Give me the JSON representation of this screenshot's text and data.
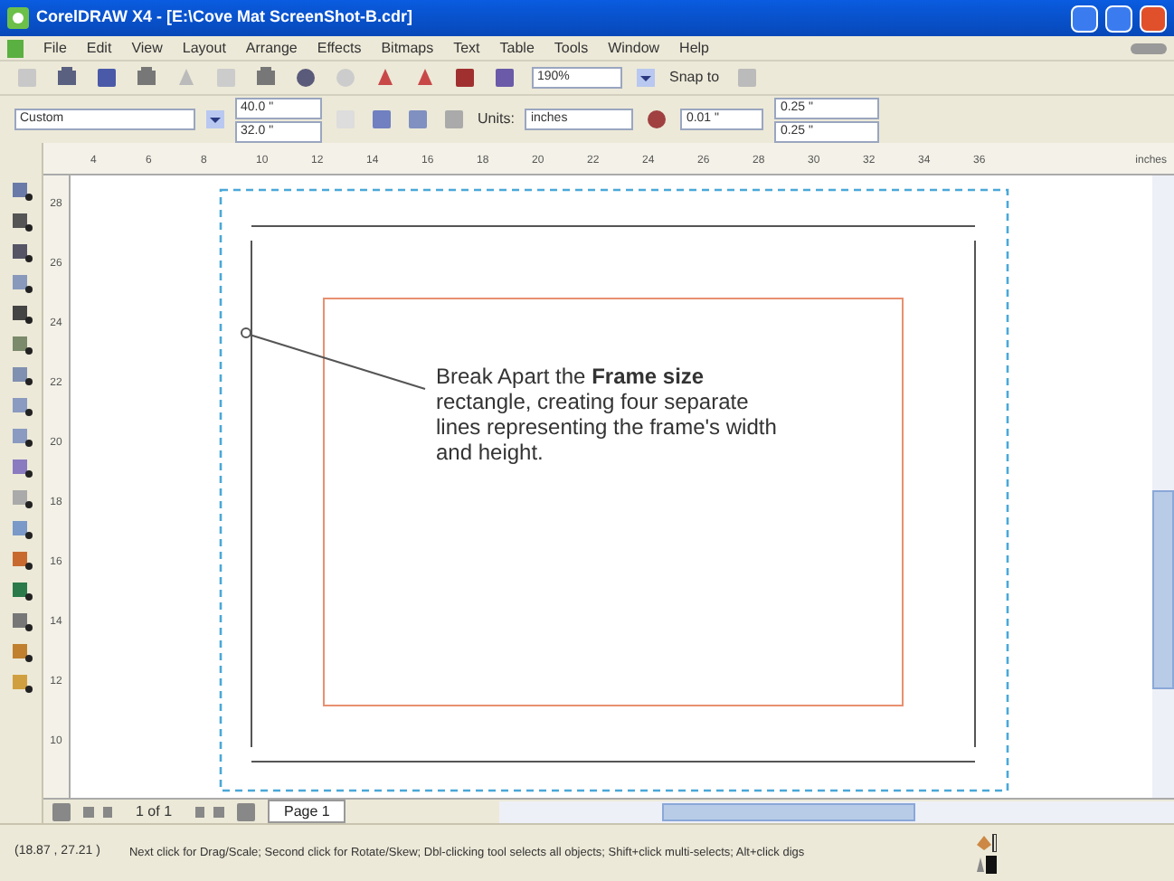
{
  "window": {
    "title": "CorelDRAW X4 - [E:\\Cove Mat ScreenShot-B.cdr]"
  },
  "menu": [
    "File",
    "Edit",
    "View",
    "Layout",
    "Arrange",
    "Effects",
    "Bitmaps",
    "Text",
    "Table",
    "Tools",
    "Window",
    "Help"
  ],
  "standard_toolbar": {
    "zoom": "190%",
    "snap_to": "Snap to"
  },
  "property_bar": {
    "paper_type": "Custom",
    "width": "40.0 \"",
    "height": "32.0 \"",
    "units_label": "Units:",
    "units": "inches",
    "nudge": "0.01 \"",
    "duplicate_x": "0.25 \"",
    "duplicate_y": "0.25 \""
  },
  "rulers": {
    "horizontal": [
      "4",
      "6",
      "8",
      "10",
      "12",
      "14",
      "16",
      "18",
      "20",
      "22",
      "24",
      "26",
      "28",
      "30",
      "32",
      "34",
      "36"
    ],
    "unit": "inches",
    "vertical": [
      "28",
      "26",
      "24",
      "22",
      "20",
      "18",
      "16",
      "14",
      "12",
      "10"
    ]
  },
  "callout": "Break Apart the **Frame size** rectangle, creating four separate lines representing the frame's width and height.",
  "page_nav": {
    "position": "1 of 1",
    "tabs": [
      {
        "label": "Page 1",
        "selected": true
      }
    ]
  },
  "status_bar": {
    "coordinates": "(18.87 , 27.21 )",
    "hint": "Next click for Drag/Scale; Second click for Rotate/Skew; Dbl-clicking tool selects all objects; Shift+click multi-selects; Alt+click digs"
  }
}
